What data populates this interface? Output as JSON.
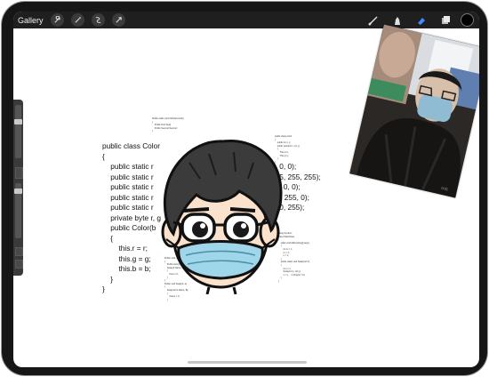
{
  "app": {
    "gallery_label": "Gallery",
    "left_tools": [
      "wrench-icon",
      "magic-wand-icon",
      "selection-icon",
      "transform-icon"
    ],
    "right_tools": [
      "brush-icon",
      "smudge-icon",
      "eraser-icon",
      "layers-icon"
    ],
    "active_tool": "eraser-icon",
    "accent_color": "#3f8cff",
    "current_color": "#000000"
  },
  "canvas": {
    "code_lines": [
      "public class Color",
      "{",
      "    public static r",
      "    public static r",
      "    public static r",
      "    public static r",
      "    public static r",
      "    private byte r, g",
      "    public Color(b",
      "    {",
      "        this.r = r;",
      "        this.g = g;",
      "        this.b = b;",
      "    }",
      "}"
    ],
    "code_tails": [
      "0, 0, 0);",
      "255, 255, 255);",
      "55, 0, 0);",
      "r(0, 255, 0);",
      "0, 0, 255);"
    ],
    "tiny_top_lines": [
      "Public static void First(Seconds)",
      "{",
      "    Public First Set()",
      "    Public Second Second;",
      "}"
    ],
    "tiny_right_lines": [
      "public class point",
      "{",
      "    public int x, y;",
      "    public point(int x, int y)",
      "    {",
      "        This.x=x;",
      "        This.y=y;",
      "    }",
      "}"
    ],
    "tiny_right2_lines": [
      "using System;",
      "class MainClass",
      "{",
      "    static void Main(string[] args)",
      "    {",
      "        int m = 1;",
      "        m = 1;",
      "        n = 1;",
      "    }",
      "    public static void Swap(ref int",
      "    {",
      "        int t = x;",
      "        Swap(ref x, ref y);",
      "        x = y;    // (Output \"x={",
      "    }",
      "}"
    ],
    "tiny_bottom_lines": [
      "Public void  get()",
      "{",
      "    Public Aset()",
      "    Swap(b.Name, b);",
      "    {",
      "        Next = 0;",
      "    }",
      "}",
      "Public void Swap(b, a)",
      "{",
      "    Swap(ref A.Name, B);",
      "    {",
      "        Name = 0;",
      "    }"
    ]
  },
  "overlay_photo": {
    "timestamp": "0:01"
  }
}
